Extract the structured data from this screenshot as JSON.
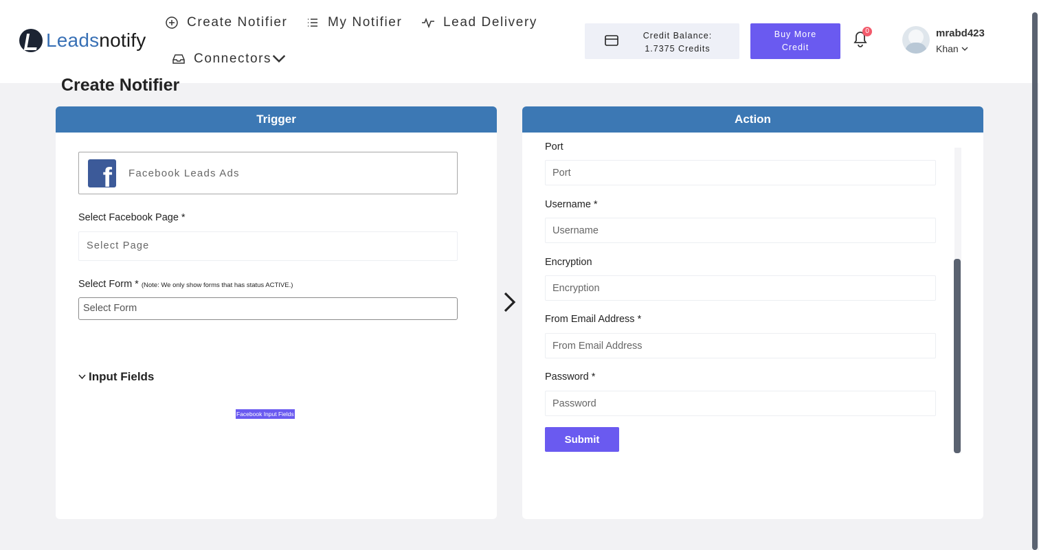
{
  "brand": {
    "logo_part1": "Leads",
    "logo_part2": "notify"
  },
  "nav": [
    {
      "label": "Create Notifier",
      "icon": "plus-circle-icon"
    },
    {
      "label": "My Notifier",
      "icon": "list-icon"
    },
    {
      "label": "Lead Delivery",
      "icon": "activity-icon"
    },
    {
      "label": "Connectors",
      "icon": "inbox-icon"
    }
  ],
  "credit": {
    "line1": "Credit Balance:",
    "line2": "1.7375 Credits"
  },
  "buy_button": {
    "line1": "Buy More",
    "line2": "Credit"
  },
  "notifications": {
    "count": "0"
  },
  "user": {
    "name": "mrabd423",
    "subname": "Khan"
  },
  "page_title": "Create Notifier",
  "trigger": {
    "title": "Trigger",
    "app_name": "Facebook Leads Ads",
    "page_label": "Select Facebook Page *",
    "page_placeholder": "Select Page",
    "form_label": "Select Form *",
    "form_note": "(Note: We only show forms that has status ACTIVE.)",
    "form_placeholder": "Select Form",
    "input_fields_label": "Input Fields",
    "input_fields_tag": "Facebook Input Fields"
  },
  "action": {
    "title": "Action",
    "fields": [
      {
        "label": "Port",
        "placeholder": "Port"
      },
      {
        "label": "Username *",
        "placeholder": "Username"
      },
      {
        "label": "Encryption",
        "placeholder": "Encryption"
      },
      {
        "label": "From Email Address *",
        "placeholder": "From Email Address"
      },
      {
        "label": "Password *",
        "placeholder": "Password"
      }
    ],
    "submit_label": "Submit"
  },
  "colors": {
    "primary_blue": "#3c78b4",
    "accent_purple": "#6a5af0",
    "badge_red": "#f25a6b"
  }
}
